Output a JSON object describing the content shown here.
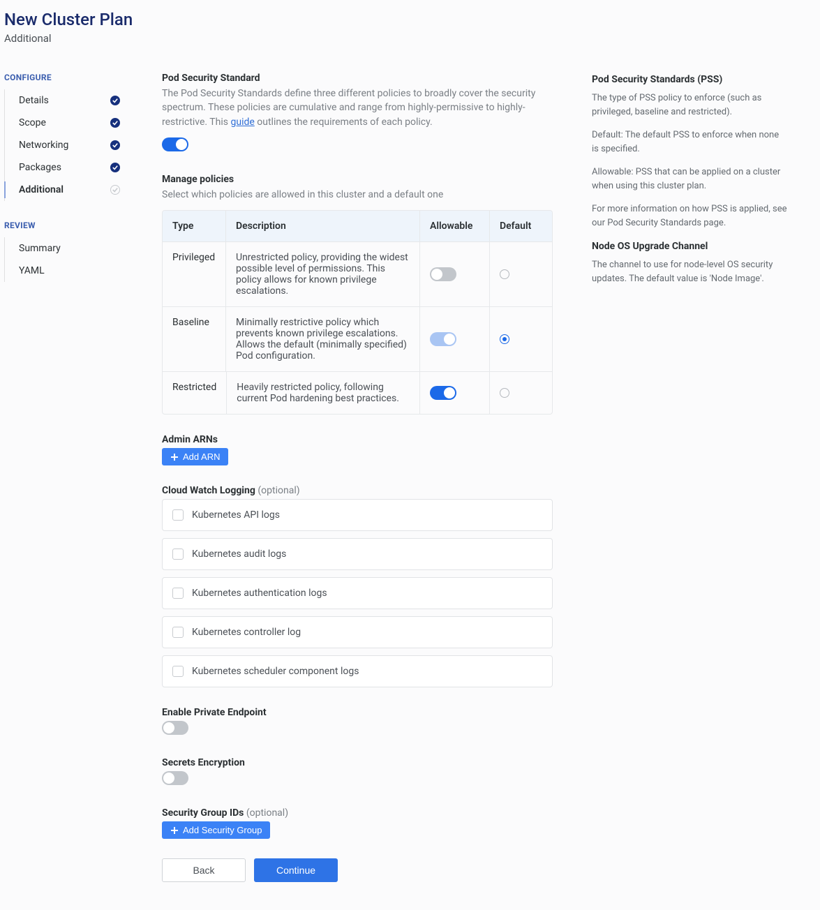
{
  "header": {
    "title": "New Cluster Plan",
    "subtitle": "Additional"
  },
  "sidebar": {
    "sections": [
      {
        "label": "CONFIGURE",
        "items": [
          {
            "label": "Details",
            "status": "done",
            "active": false
          },
          {
            "label": "Scope",
            "status": "done",
            "active": false
          },
          {
            "label": "Networking",
            "status": "done",
            "active": false
          },
          {
            "label": "Packages",
            "status": "done",
            "active": false
          },
          {
            "label": "Additional",
            "status": "pending",
            "active": true
          }
        ]
      },
      {
        "label": "REVIEW",
        "items": [
          {
            "label": "Summary",
            "status": "none",
            "active": false
          },
          {
            "label": "YAML",
            "status": "none",
            "active": false
          }
        ]
      }
    ]
  },
  "pss": {
    "title": "Pod Security Standard",
    "desc_pre": "The Pod Security Standards define three different policies to broadly cover the security spectrum. These policies are cumulative and range from highly-permissive to highly-restrictive. This ",
    "guide_link": "guide",
    "desc_post": " outlines the requirements of each policy.",
    "enabled": true
  },
  "policies": {
    "title": "Manage policies",
    "subtitle": "Select which policies are allowed in this cluster and a default one",
    "headers": {
      "type": "Type",
      "desc": "Description",
      "allow": "Allowable",
      "def": "Default"
    },
    "rows": [
      {
        "type": "Privileged",
        "desc": "Unrestricted policy, providing the widest possible level of permissions. This policy allows for known privilege escalations.",
        "allowable": "off",
        "default": false
      },
      {
        "type": "Baseline",
        "desc": "Minimally restrictive policy which prevents known privilege escalations. Allows the default (minimally specified) Pod configuration.",
        "allowable": "on-disabled",
        "default": true
      },
      {
        "type": "Restricted",
        "desc": "Heavily restricted policy, following current Pod hardening best practices.",
        "allowable": "on",
        "default": false
      }
    ]
  },
  "admin_arns": {
    "title": "Admin ARNs",
    "add_label": "Add ARN"
  },
  "logging": {
    "title": "Cloud Watch Logging",
    "optional": "(optional)",
    "items": [
      "Kubernetes API logs",
      "Kubernetes audit logs",
      "Kubernetes authentication logs",
      "Kubernetes controller log",
      "Kubernetes scheduler component logs"
    ]
  },
  "private_endpoint": {
    "title": "Enable Private Endpoint",
    "enabled": false
  },
  "secrets": {
    "title": "Secrets Encryption",
    "enabled": false
  },
  "security_groups": {
    "title": "Security Group IDs",
    "optional": "(optional)",
    "add_label": "Add Security Group"
  },
  "footer": {
    "back": "Back",
    "continue": "Continue"
  },
  "info": {
    "s1_title": "Pod Security Standards (PSS)",
    "s1_p1": "The type of PSS policy to enforce (such as privileged, baseline and restricted).",
    "s1_p2": "Default: The default PSS to enforce when none is specified.",
    "s1_p3": "Allowable: PSS that can be applied on a cluster when using this cluster plan.",
    "s1_p4": "For more information on how PSS is applied, see our Pod Security Standards page.",
    "s2_title": "Node OS Upgrade Channel",
    "s2_p1": "The channel to use for node-level OS security updates. The default value is 'Node Image'."
  }
}
